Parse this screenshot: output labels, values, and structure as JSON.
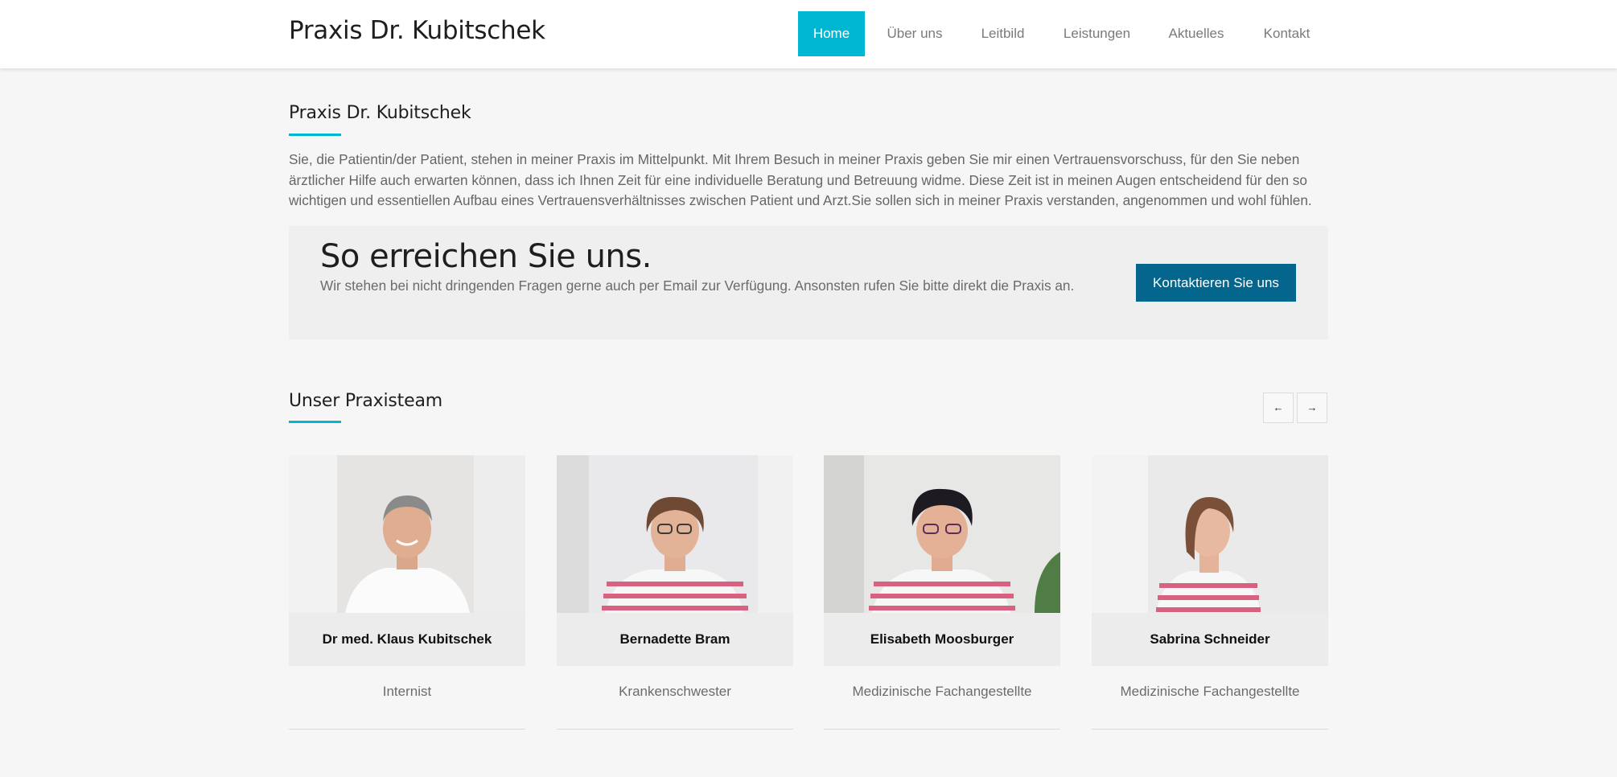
{
  "header": {
    "brand": "Praxis Dr. Kubitschek",
    "nav": [
      {
        "label": "Home",
        "active": true
      },
      {
        "label": "Über uns",
        "active": false
      },
      {
        "label": "Leitbild",
        "active": false
      },
      {
        "label": "Leistungen",
        "active": false
      },
      {
        "label": "Aktuelles",
        "active": false
      },
      {
        "label": "Kontakt",
        "active": false
      }
    ]
  },
  "intro": {
    "title": "Praxis Dr. Kubitschek",
    "text": "Sie, die Patientin/der Patient, stehen in meiner Praxis im Mittelpunkt. Mit Ihrem Besuch in meiner Praxis geben Sie mir einen Vertrauensvorschuss, für den Sie neben ärztlicher Hilfe auch erwarten können, dass ich Ihnen Zeit für eine individuelle Beratung und Betreuung widme. Diese Zeit ist in meinen Augen entscheidend für den so wichtigen und essentiellen Aufbau eines Vertrauensverhältnisses zwischen Patient und Arzt.Sie sollen sich in meiner Praxis verstanden, angenommen und wohl fühlen."
  },
  "cta": {
    "title": "So erreichen Sie uns.",
    "text": "Wir stehen bei nicht dringenden Fragen gerne auch per Email zur Verfügung. Ansonsten rufen Sie bitte direkt die Praxis an.",
    "button_label": "Kontaktieren Sie uns"
  },
  "team": {
    "title": "Unser Praxisteam",
    "prev_icon": "←",
    "next_icon": "→",
    "members": [
      {
        "name": "Dr med. Klaus Kubitschek",
        "role": "Internist"
      },
      {
        "name": "Bernadette Bram",
        "role": "Krankenschwester"
      },
      {
        "name": "Elisabeth Moosburger",
        "role": "Medizinische Fachangestellte"
      },
      {
        "name": "Sabrina Schneider",
        "role": "Medizinische Fachangestellte"
      }
    ]
  },
  "colors": {
    "accent": "#00b7d3",
    "button": "#04668c",
    "background": "#f6f6f6"
  }
}
